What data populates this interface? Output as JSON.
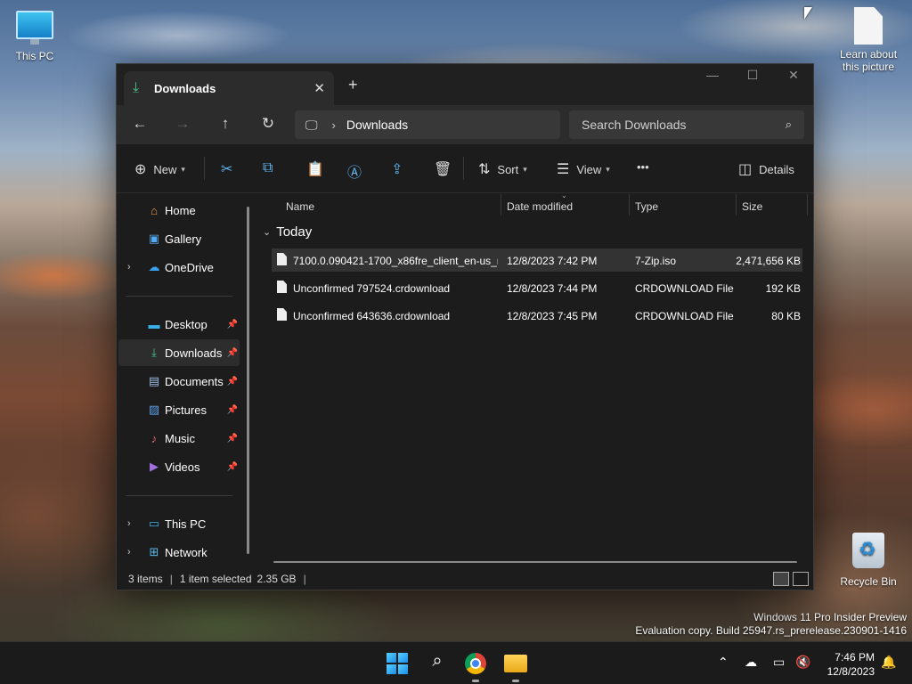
{
  "desktop": {
    "icons": {
      "this_pc": "This PC",
      "learn": "Learn about this picture",
      "recycle_bin": "Recycle Bin"
    },
    "watermark": {
      "line1": "Windows 11 Pro Insider Preview",
      "line2": "Evaluation copy. Build 25947.rs_prerelease.230901-1416"
    }
  },
  "window": {
    "tab_title": "Downloads",
    "tab_close": "✕",
    "new_tab": "+",
    "caption": {
      "minimize": "—",
      "maximize": "☐",
      "close": "✕"
    },
    "address": {
      "chevron": "›",
      "crumb": "Downloads"
    },
    "search": {
      "placeholder": "Search Downloads"
    },
    "toolbar": {
      "new_label": "New",
      "sort_label": "Sort",
      "view_label": "View",
      "more_label": "•••",
      "details_label": "Details"
    },
    "nav": {
      "home": "Home",
      "gallery": "Gallery",
      "onedrive": "OneDrive",
      "desktop": "Desktop",
      "downloads": "Downloads",
      "documents": "Documents",
      "pictures": "Pictures",
      "music": "Music",
      "videos": "Videos",
      "this_pc": "This PC",
      "network": "Network"
    },
    "columns": {
      "name": "Name",
      "date": "Date modified",
      "type": "Type",
      "size": "Size"
    },
    "group_label": "Today",
    "files": [
      {
        "name": "7100.0.090421-1700_x86fre_client_en-us_r...",
        "date": "12/8/2023 7:42 PM",
        "type": "7-Zip.iso",
        "size": "2,471,656 KB"
      },
      {
        "name": "Unconfirmed 797524.crdownload",
        "date": "12/8/2023 7:44 PM",
        "type": "CRDOWNLOAD File",
        "size": "192 KB"
      },
      {
        "name": "Unconfirmed 643636.crdownload",
        "date": "12/8/2023 7:45 PM",
        "type": "CRDOWNLOAD File",
        "size": "80 KB"
      }
    ],
    "status": {
      "items": "3 items",
      "selected": "1 item selected",
      "size": "2.35 GB"
    }
  },
  "taskbar": {
    "time": "7:46 PM",
    "date": "12/8/2023"
  },
  "colors": {
    "accent": "#60b4f0",
    "downloads_green": "#4cc38a",
    "window_bg": "#1c1c1c"
  }
}
